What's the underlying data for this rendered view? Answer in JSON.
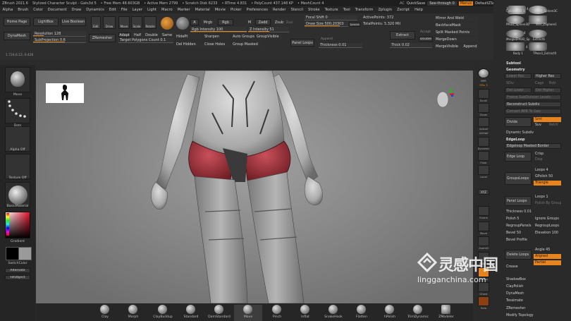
{
  "title_bar": {
    "items": [
      "ZBrush 2021.6",
      "Stylized Character Sculpt - Gats3d 5",
      "• Free Mem 48.603GB",
      "• Active Mem 2799",
      "• Scratch Disk 6233",
      "• RTime 4.831",
      "• PolyCount 437.148 KP",
      "• MeshCount 4"
    ],
    "ac": "AC",
    "quicksave": "QuickSave",
    "see_through": "See-through 0",
    "menus": "Menus",
    "default_zscript": "DefaultZScript"
  },
  "menu_bar": [
    "Alpha",
    "Brush",
    "Color",
    "Document",
    "Draw",
    "Dynamics",
    "Edit",
    "File",
    "Layer",
    "Light",
    "Macro",
    "Marker",
    "Material",
    "Movie",
    "Picker",
    "Preferences",
    "Render",
    "Stencil",
    "Stroke",
    "Texture",
    "Tool",
    "Transform",
    "Zplugin",
    "Zscript",
    "Help"
  ],
  "top_shelf": {
    "home_page": "Home Page",
    "lightbox": "LightBox",
    "live_boolean": "Live Boolean",
    "edit": "Edit",
    "draw": "Draw",
    "move": "Move",
    "scale": "Scale",
    "rotate": "Rotate",
    "dynamesh": "DynaMesh",
    "resolution": "Resolution 128",
    "resolution_value": 128,
    "subprojection": "SubProjection 0.6",
    "zremesher": "ZRemesher",
    "adapt": "Adapt",
    "half": "Half",
    "double": "Double",
    "same": "Same",
    "target_polygons": "Target Polygons Count 0.1",
    "a": "A",
    "mrgb": "Mrgb",
    "rgb": "Rgb",
    "m": "M",
    "zadd": "Zadd",
    "zsub": "Zsub",
    "zcut": "Zcut",
    "rgb_intensity": "Rgb Intensity 100",
    "z_intensity": "Z Intensity 51",
    "z_intensity_value": 51,
    "hidept": "HidePt",
    "del_hidden": "Del Hidden",
    "close_holes": "Close Holes",
    "group_mask": "Group Masked",
    "auto_groups": "Auto Groups",
    "group_visible": "GroupVisible",
    "sharpen": "Sharpen",
    "focal_shift": "Focal Shift 0",
    "draw_size": "Draw Size 500.20303",
    "dynamic": "Dynamic",
    "active_points": "ActivePoints: 372",
    "total_points": "TotalPoints: 5.320 Mil",
    "panel_loops": "Panel Loops",
    "append": "Append",
    "thickness": "Thickness 0.01",
    "extract": "Extract",
    "accept": "Accept",
    "double2": "Double",
    "thick": "Thick 0.02",
    "mirror_and_weld": "Mirror And Weld",
    "backface_mask": "BackfaceMask",
    "split_masked": "Split Masked Points",
    "merge_down": "MergeDown",
    "merge_visible": "MergeVisible",
    "append2": "Append",
    "coords": "1.724,6.12,-0.426"
  },
  "left_panel": {
    "move": "Move",
    "dots": "Dots",
    "alpha_off": "Alpha Off",
    "texture_off": "Texture Off",
    "basic_material": "BasicMaterial",
    "gradient": "Gradient",
    "switch_color": "SwitchColor",
    "alternate": "Alternate",
    "fill_object": "FillObject"
  },
  "right_toolbar": [
    "BPR",
    "SPix 3",
    "Scroll",
    "Zoom",
    "Actual",
    "AAHalf",
    "Dynamic Persp",
    "Floor",
    "Local",
    "XYZ",
    "Frame",
    "Move",
    "ZoomD",
    "Rotate",
    "Transp",
    "Ghost",
    "Solo"
  ],
  "right_panel": {
    "thumbs": [
      "Cylinder3D_1",
      "PM3D_Sphere3C",
      "PM3D_Sphere3D",
      "Skin_ZSphere1",
      "MergedPM3D_Sp",
      "Extract6",
      "Body 1",
      "TPose1_Extract0"
    ],
    "thumb_counts": [
      "3",
      "4",
      "4",
      "4"
    ],
    "subtool": "Subtool",
    "geometry": "Geometry",
    "lower_res": "Lower Res",
    "higher_res": "Higher Res",
    "sdiv": "SDiv",
    "cage": "Cage",
    "rstr": "Rstr",
    "del_lower": "Del Lower",
    "del_higher": "Del Higher",
    "freeze_subdiv": "Freeze SubDivision Levels",
    "reconstruct_subdiv": "Reconstruct Subdiv",
    "convert_bpr": "Convert BPR To Geo",
    "divide": "Divide",
    "smt": "Smt",
    "suv": "Suv",
    "reuv": "ReUV",
    "dynamic_subdiv": "Dynamic Subdiv",
    "edgeloop": "EdgeLoop",
    "edgeloop_masked_border": "Edgeloop Masked Border",
    "edge_loop": "Edge Loop",
    "crisp": "Crisp",
    "disp": "Disp",
    "grouploops": "GroupsLoops",
    "loops": "Loops 4",
    "gpolish": "GPolish 50",
    "triangle": "Triangle",
    "panel_loops": "Panel Loops",
    "loops2": "Loops 1",
    "polish_by_groups": "Polish By Groups",
    "thickness": "Thickness 0.01",
    "polish": "Polish 5",
    "ignore_groups": "Ignore Groups",
    "regroup_panels": "RegroupPanels",
    "regroup_loops": "RegroupLoops",
    "bevel": "Bevel 50",
    "elevation": "Elevation 100",
    "bevel_profile": "Bevel Profile",
    "delete_loops": "Delete Loops",
    "angle": "Angle 45",
    "aligned": "Aligned",
    "partial": "Partial",
    "crease": "Crease",
    "shadowbox": "ShadowBox",
    "claypolish": "ClayPolish",
    "dynamesh": "DynaMesh",
    "tessimate": "Tessimate",
    "zremesher": "ZRemesher",
    "modify_topology": "Modify Topology"
  },
  "bottom_shelf": [
    "Clay",
    "Morph",
    "ClayBuildup",
    "Standard",
    "DamStandard",
    "Move",
    "Pinch",
    "Inflat",
    "SnakeHook",
    "Flatten",
    "hPolish",
    "TrimDynamic",
    "ZModeler"
  ],
  "bottom_selected": "Move",
  "watermark": {
    "cn": "灵感中国",
    "url": "lingganchina.com"
  },
  "colors": {
    "accent": "#e8841e",
    "bg": "#2b2b2b",
    "canvas": "#8a8a8a",
    "red_mesh": "#a8333c"
  }
}
